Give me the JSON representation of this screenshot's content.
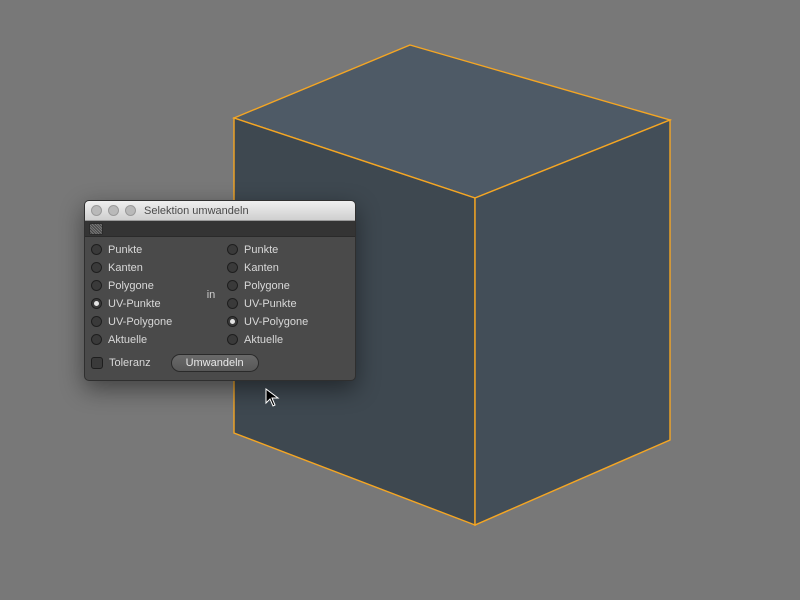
{
  "dialog": {
    "title": "Selektion umwandeln",
    "connector_label": "in",
    "left": {
      "options": [
        "Punkte",
        "Kanten",
        "Polygone",
        "UV-Punkte",
        "UV-Polygone",
        "Aktuelle"
      ],
      "selected": "UV-Punkte"
    },
    "right": {
      "options": [
        "Punkte",
        "Kanten",
        "Polygone",
        "UV-Punkte",
        "UV-Polygone",
        "Aktuelle"
      ],
      "selected": "UV-Polygone"
    },
    "tolerance_label": "Toleranz",
    "tolerance_checked": false,
    "submit_label": "Umwandeln"
  },
  "viewport": {
    "object": "cube",
    "selection_color": "#f5a623",
    "face_colors": {
      "top": "#4e5a66",
      "left": "#3e4850",
      "right": "#434e58"
    }
  }
}
